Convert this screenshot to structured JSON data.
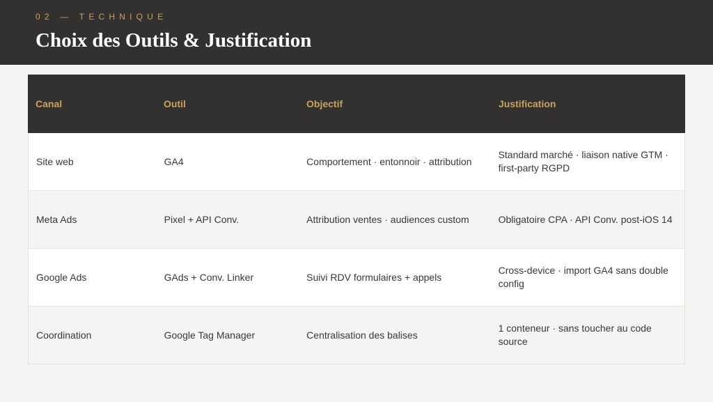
{
  "header": {
    "eyebrow": "02 — TECHNIQUE",
    "title": "Choix des Outils & Justification"
  },
  "table": {
    "columns": [
      "Canal",
      "Outil",
      "Objectif",
      "Justification"
    ],
    "rows": [
      [
        "Site web",
        "GA4",
        "Comportement · entonnoir · attribution",
        "Standard marché · liaison native GTM · first-party RGPD"
      ],
      [
        "Meta Ads",
        "Pixel + API Conv.",
        "Attribution ventes · audiences custom",
        "Obligatoire CPA · API Conv. post-iOS 14"
      ],
      [
        "Google Ads",
        "GAds + Conv. Linker",
        "Suivi RDV formulaires + appels",
        "Cross-device · import GA4 sans double config"
      ],
      [
        "Coordination",
        "Google Tag Manager",
        "Centralisation des balises",
        "1 conteneur · sans toucher au code source"
      ]
    ]
  },
  "colors": {
    "header_bg": "#323130",
    "accent": "#c9a25f",
    "row_alt": "#f5f4f2",
    "text": "#3a3836"
  }
}
